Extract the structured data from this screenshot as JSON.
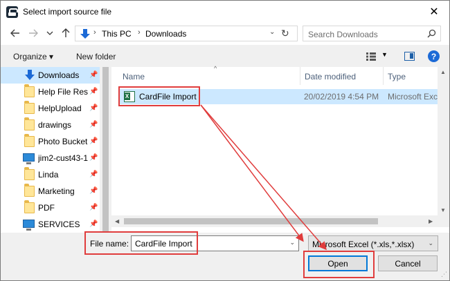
{
  "window": {
    "title": "Select import source file",
    "close_label": "✕"
  },
  "navigation": {
    "back_icon": "back-arrow-icon",
    "forward_icon": "forward-arrow-icon",
    "recent_icon": "chevron-down-icon",
    "up_icon": "up-arrow-icon"
  },
  "address": {
    "crumbs": [
      "This PC",
      "Downloads"
    ],
    "refresh_icon": "refresh-icon"
  },
  "search": {
    "placeholder": "Search Downloads"
  },
  "toolbar": {
    "organize_label": "Organize ▾",
    "new_folder_label": "New folder",
    "help_label": "?"
  },
  "sidebar": {
    "items": [
      {
        "label": "Downloads",
        "icon": "download-icon",
        "pinned": true,
        "selected": true
      },
      {
        "label": "Help File Reso",
        "icon": "folder-icon",
        "pinned": true
      },
      {
        "label": "HelpUpload",
        "icon": "folder-icon",
        "pinned": true
      },
      {
        "label": "drawings",
        "icon": "folder-icon",
        "pinned": true
      },
      {
        "label": "Photo Bucket",
        "icon": "folder-icon",
        "pinned": true
      },
      {
        "label": "jim2-cust43-1",
        "icon": "monitor-icon",
        "pinned": true
      },
      {
        "label": "Linda",
        "icon": "folder-icon",
        "pinned": true
      },
      {
        "label": "Marketing",
        "icon": "folder-icon",
        "pinned": true
      },
      {
        "label": "PDF",
        "icon": "folder-icon",
        "pinned": true
      },
      {
        "label": "SERVICES",
        "icon": "monitor-icon",
        "pinned": true
      }
    ]
  },
  "file_list": {
    "columns": [
      "Name",
      "Date modified",
      "Type"
    ],
    "rows": [
      {
        "name": "CardFile Import",
        "date": "20/02/2019 4:54 PM",
        "type": "Microsoft Excel W",
        "icon": "excel-icon",
        "selected": true
      }
    ]
  },
  "footer": {
    "file_name_label": "File name:",
    "file_name_value": "CardFile Import",
    "filter_value": "Microsoft Excel (*.xls,*.xlsx)",
    "open_label": "Open",
    "cancel_label": "Cancel"
  },
  "colors": {
    "highlight": "#e03c3c",
    "selection": "#cce8ff",
    "accent": "#0078d7"
  }
}
